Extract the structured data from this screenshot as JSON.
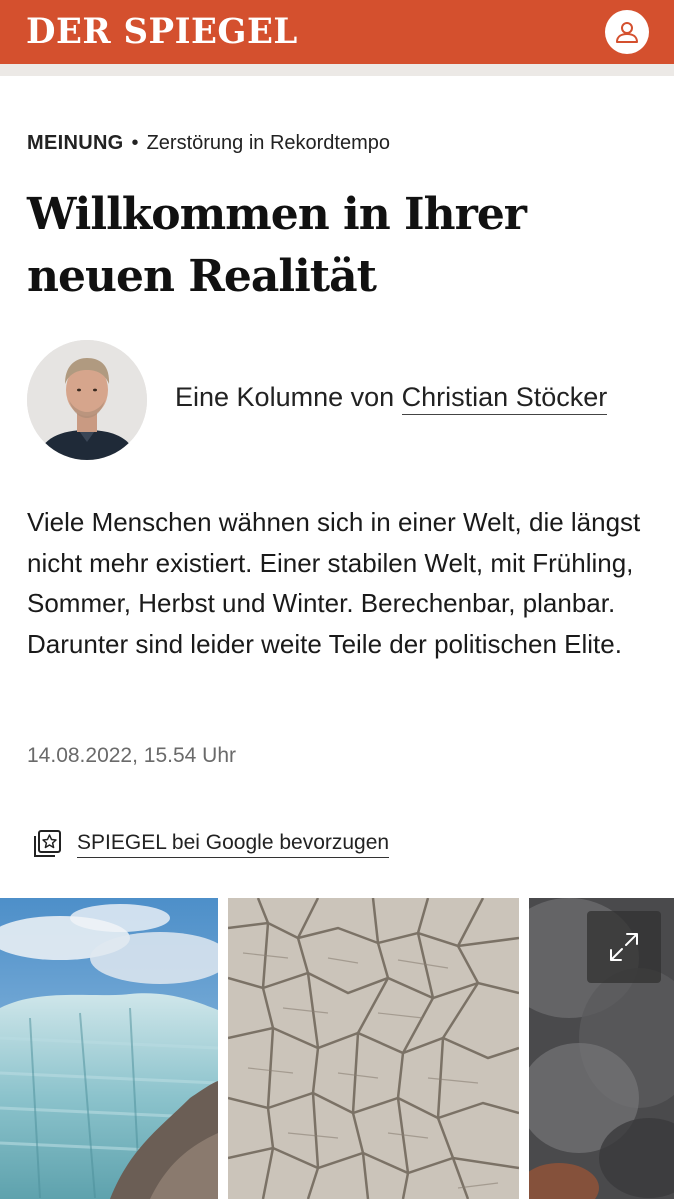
{
  "header": {
    "logo": "DER SPIEGEL",
    "brand_color": "#d4502e",
    "account_icon": "user-icon"
  },
  "article": {
    "section": "MEINUNG",
    "separator": "•",
    "topic": "Zerstörung in Rekordtempo",
    "headline": "Willkommen in Ihrer neuen Realität",
    "byline_prefix": "Eine Kolumne von",
    "author": "Christian Stöcker",
    "teaser": "Viele Menschen wähnen sich in einer Welt, die längst nicht mehr existiert. Einer stabilen Welt, mit Frühling, Sommer, Herbst und Winter. Berechenbar, planbar. Darunter sind leider weite Teile der politischen Elite.",
    "date": "14.08.2022, 15.54 Uhr"
  },
  "google": {
    "label": "SPIEGEL bei Google bevorzugen",
    "icon": "star-bookmark-icon"
  },
  "gallery": {
    "images": [
      "glacier-image",
      "dry-cracked-earth-image",
      "smoke-image"
    ],
    "expand_icon": "expand-icon"
  }
}
